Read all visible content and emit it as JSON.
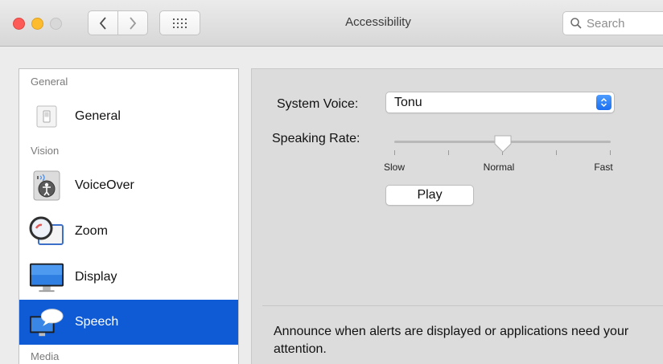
{
  "window": {
    "title": "Accessibility",
    "search_placeholder": "Search"
  },
  "sidebar": {
    "sections": [
      {
        "header": "General"
      },
      {
        "header": "Vision"
      },
      {
        "header": "Media"
      }
    ],
    "items": [
      {
        "label": "General",
        "icon": "switch-icon",
        "selected": false
      },
      {
        "label": "VoiceOver",
        "icon": "voiceover-icon",
        "selected": false
      },
      {
        "label": "Zoom",
        "icon": "magnifier-icon",
        "selected": false
      },
      {
        "label": "Display",
        "icon": "monitor-icon",
        "selected": false
      },
      {
        "label": "Speech",
        "icon": "speech-bubble-icon",
        "selected": true
      }
    ],
    "selected_color": "#0f5bd6"
  },
  "speech": {
    "system_voice_label": "System Voice:",
    "system_voice_value": "Tonu",
    "speaking_rate_label": "Speaking Rate:",
    "rate_ticks": [
      "Slow",
      "Normal",
      "Fast"
    ],
    "rate_value": 0.5,
    "play_label": "Play",
    "announce_text": "Announce when alerts are displayed or applications need your attention."
  }
}
